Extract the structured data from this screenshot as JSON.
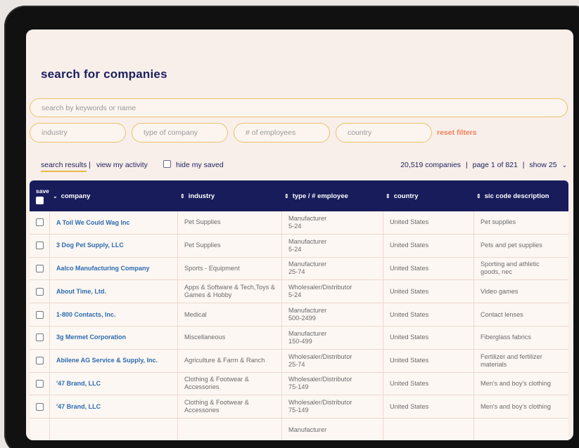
{
  "page": {
    "title": "search for companies"
  },
  "search": {
    "placeholder": "search by keywords or name"
  },
  "filters": {
    "industry": "industry",
    "type": "type of company",
    "employees": "# of employees",
    "country": "country",
    "reset": "reset filters"
  },
  "toolbar": {
    "tab_results": "search results",
    "tab_activity": "view my activity",
    "hide_saved": "hide my saved",
    "count": "20,519 companies",
    "page": "page 1 of 821",
    "show": "show 25",
    "divider": "|"
  },
  "table": {
    "headers": {
      "save": "save",
      "company": "company",
      "industry": "industry",
      "type": "type / # employee",
      "country": "country",
      "sic": "sic code description"
    },
    "rows": [
      {
        "company": "A Toil We Could Wag Inc",
        "industry": "Pet Supplies",
        "type": "Manufacturer\n5-24",
        "country": "United States",
        "sic": "Pet supplies"
      },
      {
        "company": "3 Dog Pet Supply, LLC",
        "industry": "Pet Supplies",
        "type": "Manufacturer\n5-24",
        "country": "United States",
        "sic": "Pets and pet supplies"
      },
      {
        "company": "Aalco Manufacturing Company",
        "industry": "Sports - Equipment",
        "type": "Manufacturer\n25-74",
        "country": "United States",
        "sic": "Sporting and athletic\ngoods, nec"
      },
      {
        "company": "About Time, Ltd.",
        "industry": "Apps & Software & Tech,Toys &\nGames & Hobby",
        "type": "Wholesaler/Distributor\n5-24",
        "country": "United States",
        "sic": "Video games"
      },
      {
        "company": "1-800 Contacts, Inc.",
        "industry": "Medical",
        "type": "Manufacturer\n500-2499",
        "country": "United States",
        "sic": "Contact lenses"
      },
      {
        "company": "3g Mermet Corporation",
        "industry": "Miscellaneous",
        "type": "Manufacturer\n150-499",
        "country": "United States",
        "sic": "Fiberglass fabrics"
      },
      {
        "company": "Abilene AG Service & Supply, Inc.",
        "industry": "Agriculture & Farm & Ranch",
        "type": "Wholesaler/Distributor\n25-74",
        "country": "United States",
        "sic": "Fertilizer and fertilizer\nmaterials"
      },
      {
        "company": "'47 Brand, LLC",
        "industry": "Clothing & Footwear &\nAccessories",
        "type": "Wholesaler/Distributor\n75-149",
        "country": "United States",
        "sic": "Men's and boy's clothing"
      },
      {
        "company": "'47 Brand, LLC",
        "industry": "Clothing & Footwear &\nAccessories",
        "type": "Wholesaler/Distributor\n75-149",
        "country": "United States",
        "sic": "Men's and boy's clothing"
      },
      {
        "company": "",
        "industry": "",
        "type": "Manufacturer",
        "country": "",
        "sic": ""
      }
    ]
  }
}
